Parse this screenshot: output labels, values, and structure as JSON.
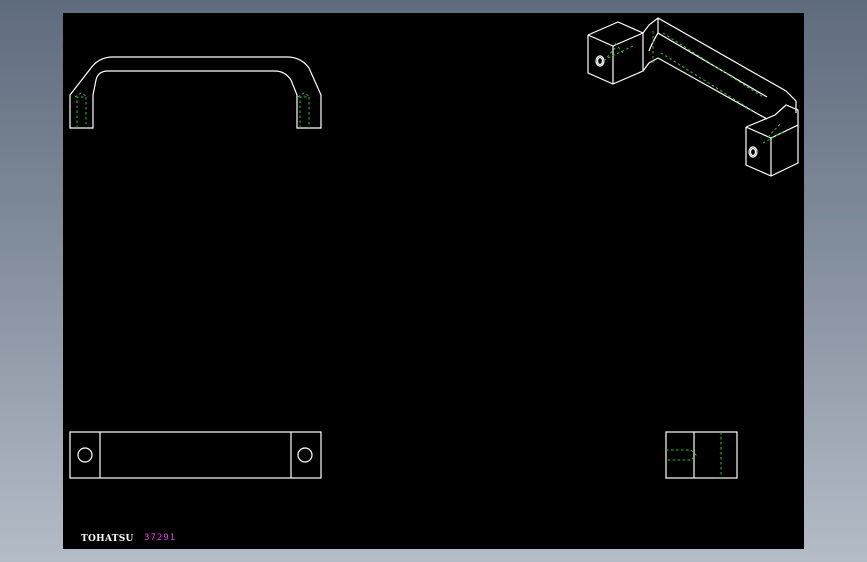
{
  "title_block": {
    "brand": "TOHATSU",
    "part_number": "37291"
  },
  "colors": {
    "background": "#000000",
    "outline": "#ffffff",
    "hidden_line": "#21c62a",
    "part_number": "#e83ee8"
  }
}
